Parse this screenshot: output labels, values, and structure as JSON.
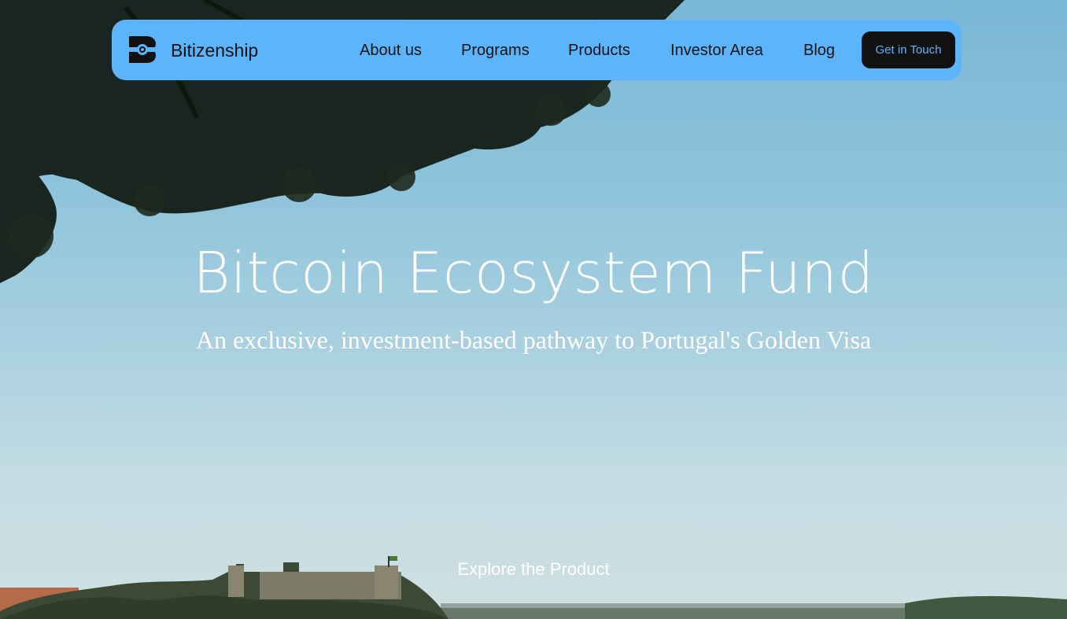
{
  "navbar": {
    "brand": "Bitizenship",
    "links": [
      "About us",
      "Programs",
      "Products",
      "Investor Area",
      "Blog"
    ],
    "cta_label": "Get in Touch"
  },
  "hero": {
    "title": "Bitcoin Ecosystem Fund",
    "subtitle": "An exclusive, investment-based pathway to Portugal's Golden Visa",
    "explore_label": "Explore the Product"
  },
  "colors": {
    "nav_background": "#5cb4fd",
    "cta_background": "#111111",
    "cta_text": "#5cb4fd",
    "hero_text": "#ffffff"
  },
  "icons": {
    "logo": "bitizenship-logo-icon"
  }
}
